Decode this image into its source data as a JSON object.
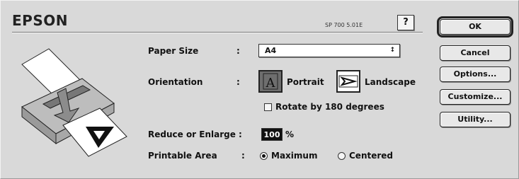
{
  "header": {
    "brand": "EPSON",
    "model": "SP 700 5.01E",
    "help_label": "?"
  },
  "paper_size": {
    "label": "Paper Size",
    "colon": ":",
    "value": "A4",
    "arrows": "↕"
  },
  "orientation": {
    "label": "Orientation",
    "colon": ":",
    "portrait_label": "Portrait",
    "landscape_label": "Landscape",
    "selected": "portrait"
  },
  "rotate": {
    "label": "Rotate by 180 degrees",
    "checked": false
  },
  "reduce": {
    "label": "Reduce or Enlarge :",
    "value": "100",
    "unit": "%"
  },
  "printable_area": {
    "label": "Printable Area",
    "colon": ":",
    "options": [
      "Maximum",
      "Centered"
    ],
    "selected": "Maximum"
  },
  "buttons": {
    "ok": "OK",
    "cancel": "Cancel",
    "options": "Options...",
    "customize": "Customize...",
    "utility": "Utility..."
  }
}
